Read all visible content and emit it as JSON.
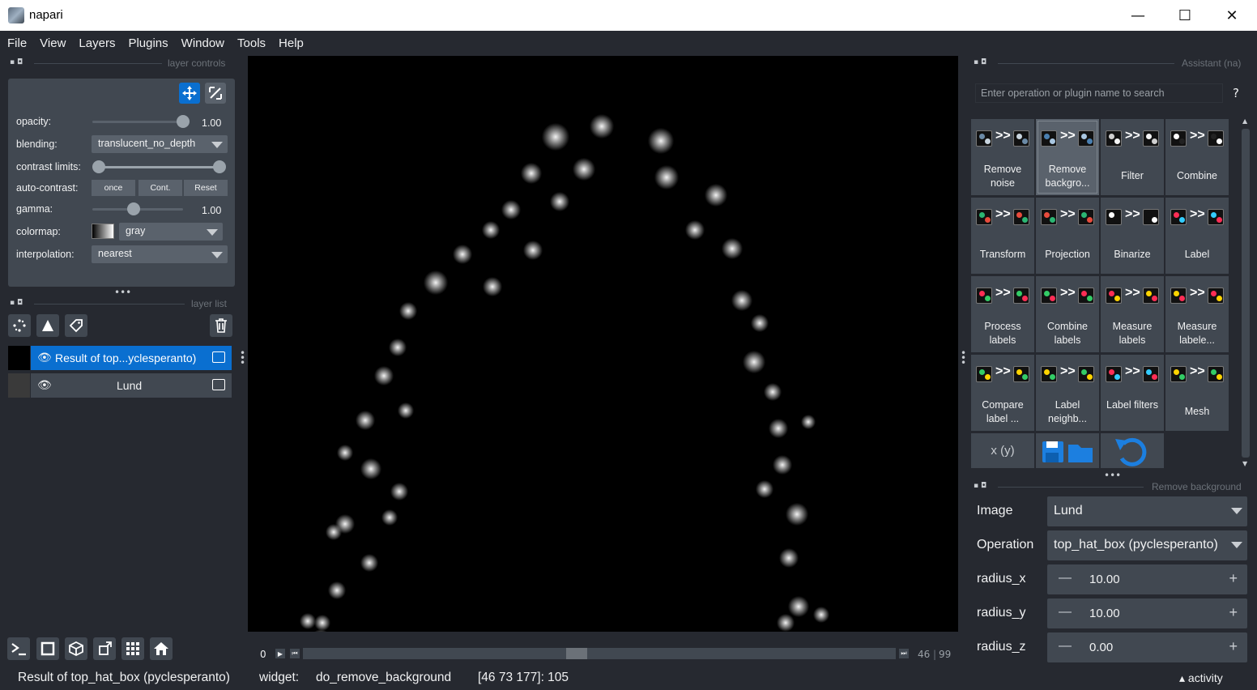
{
  "window": {
    "title": "napari",
    "minimize": "—",
    "maximize": "☐",
    "close": "✕"
  },
  "menu": [
    "File",
    "View",
    "Layers",
    "Plugins",
    "Window",
    "Tools",
    "Help"
  ],
  "layer_controls": {
    "header": "layer controls",
    "opacity_label": "opacity:",
    "opacity_value": "1.00",
    "opacity_level": 1.0,
    "blending_label": "blending:",
    "blending_value": "translucent_no_depth",
    "contrast_label": "contrast limits:",
    "autocontrast_label": "auto-contrast:",
    "once": "once",
    "cont": "Cont.",
    "reset": "Reset",
    "gamma_label": "gamma:",
    "gamma_value": "1.00",
    "colormap_label": "colormap:",
    "colormap_value": "gray",
    "interpolation_label": "interpolation:",
    "interpolation_value": "nearest"
  },
  "layer_list": {
    "header": "layer list",
    "layers": [
      {
        "name": "Result of top...yclesperanto)",
        "selected": true
      },
      {
        "name": "Lund",
        "selected": false
      }
    ]
  },
  "dims": {
    "start": "0",
    "current": "46",
    "max": "99",
    "position": 0.46
  },
  "status": {
    "layer": "Result of top_hat_box (pyclesperanto)",
    "widget_label": "widget:",
    "widget": "do_remove_background",
    "coords": "[46 73 177]: 105",
    "activity": "activity"
  },
  "assistant": {
    "header": "Assistant (na)",
    "search_placeholder": "Enter operation or plugin name to search",
    "help": "?",
    "tiles": [
      {
        "label": "Remove noise",
        "selected": false
      },
      {
        "label": "Remove backgro...",
        "selected": true
      },
      {
        "label": "Filter",
        "selected": false
      },
      {
        "label": "Combine",
        "selected": false
      },
      {
        "label": "Transform",
        "selected": false
      },
      {
        "label": "Projection",
        "selected": false
      },
      {
        "label": "Binarize",
        "selected": false
      },
      {
        "label": "Label",
        "selected": false
      },
      {
        "label": "Process labels",
        "selected": false
      },
      {
        "label": "Combine labels",
        "selected": false
      },
      {
        "label": "Measure labels",
        "selected": false
      },
      {
        "label": "Measure labele...",
        "selected": false
      },
      {
        "label": "Compare label ...",
        "selected": false
      },
      {
        "label": "Label neighb...",
        "selected": false
      },
      {
        "label": "Label filters",
        "selected": false
      },
      {
        "label": "Mesh",
        "selected": false
      }
    ],
    "code_label": "x (y)"
  },
  "remove_background": {
    "header": "Remove background",
    "image_label": "Image",
    "image_value": "Lund",
    "operation_label": "Operation",
    "operation_value": "top_hat_box (pyclesperanto)",
    "radius_x_label": "radius_x",
    "radius_x": "10.00",
    "radius_y_label": "radius_y",
    "radius_y": "10.00",
    "radius_z_label": "radius_z",
    "radius_z": "0.00"
  },
  "colors": {
    "bg": "#262930",
    "panel": "#414851",
    "accent": "#0a6fd0",
    "canvas": "#000000"
  }
}
